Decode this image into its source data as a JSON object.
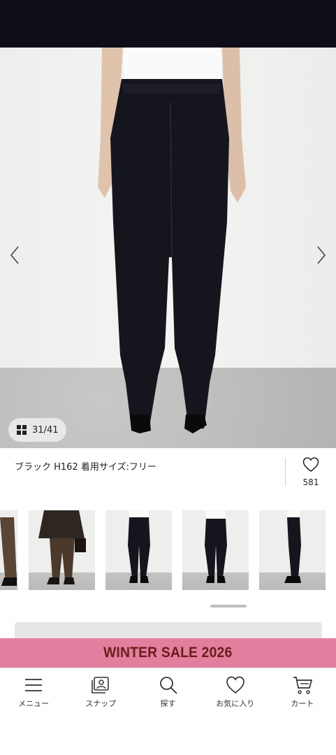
{
  "gallery": {
    "counter_current": "31",
    "counter_sep": "/",
    "counter_total": "41",
    "caption": "ブラック H162 着用サイズ:フリー",
    "favorites_count": "581"
  },
  "promo": {
    "banner_text": "WINTER SALE 2026",
    "banner_color": "#e27f9f",
    "text_color": "#6b1d1d"
  },
  "tabbar": {
    "items": [
      {
        "label": "メニュー",
        "icon": "hamburger-menu-icon"
      },
      {
        "label": "スナップ",
        "icon": "snap-photo-icon"
      },
      {
        "label": "探す",
        "icon": "search-icon"
      },
      {
        "label": "お気に入り",
        "icon": "heart-icon"
      },
      {
        "label": "カート",
        "icon": "cart-icon"
      }
    ]
  }
}
